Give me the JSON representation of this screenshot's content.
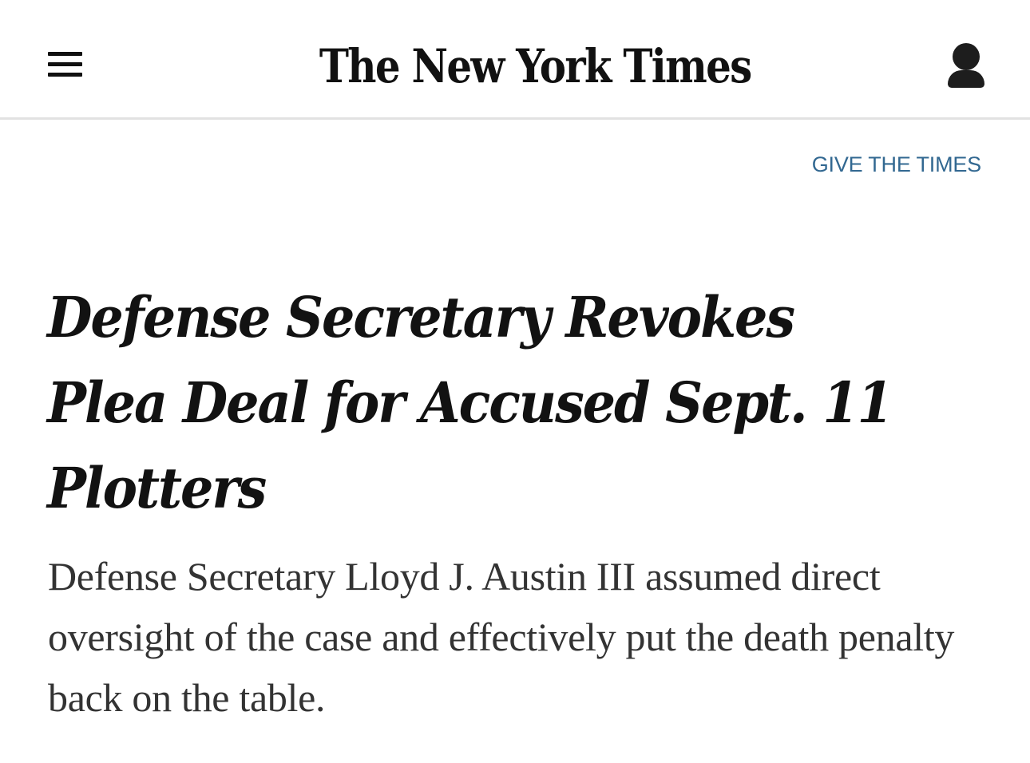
{
  "header": {
    "menu_icon": "hamburger-menu-icon",
    "logo_text": "The New York Times",
    "account_icon": "user-account-icon"
  },
  "promo": {
    "give_label": "GIVE THE TIMES"
  },
  "article": {
    "headline": "Defense Secretary Revokes Plea Deal for Accused Sept. 11 Plotters",
    "summary": "Defense Secretary Lloyd J. Austin III assumed direct oversight of the case and effectively put the death penalty back on the table."
  },
  "colors": {
    "link": "#326891",
    "text": "#121212",
    "summary_text": "#333333",
    "divider": "#e2e2e2"
  }
}
